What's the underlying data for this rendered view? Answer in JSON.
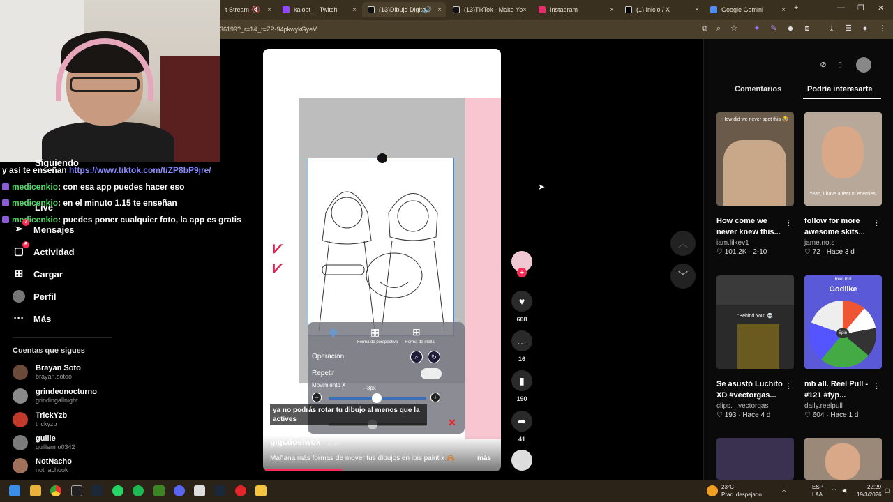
{
  "browser": {
    "tabs": [
      {
        "label": "t Stream - V",
        "color": "#b3372e"
      },
      {
        "label": "kalobt_ - Twitch",
        "color": "#9147ff"
      },
      {
        "label": "(13)Dibujo Digita",
        "color": "#111111"
      },
      {
        "label": "(13)TikTok - Make Yo",
        "color": "#111111"
      },
      {
        "label": "Instagram",
        "color": "#e1306c"
      },
      {
        "label": "(1) Inicio / X",
        "color": "#000000"
      },
      {
        "label": "Google Gemini",
        "color": "#4f8df5"
      }
    ],
    "new_tab": "+",
    "url": "36199?_r=1&_t=ZP-94pkwykGyeV"
  },
  "chat": [
    {
      "user": "",
      "text": "y así te enseñan ",
      "link": "https://www.tiktok.com/t/ZP8bP9jre/"
    },
    {
      "user": "medicenkio",
      "text": ": con esa app puedes hacer eso",
      "link": ""
    },
    {
      "user": "medicenkio",
      "text": ": en el minuto 1.15 te enseñan",
      "link": ""
    },
    {
      "user": "medicenkio",
      "text": ": puedes poner cualquier foto, la app es gratis",
      "link": ""
    }
  ],
  "sidebar": {
    "partial_items": [
      "Siguiendo",
      "Live"
    ],
    "items": [
      {
        "label": "Mensajes",
        "icon": "send-icon",
        "badge": "7"
      },
      {
        "label": "Actividad",
        "icon": "inbox-icon",
        "badge": "6"
      },
      {
        "label": "Cargar",
        "icon": "plus-icon",
        "badge": ""
      },
      {
        "label": "Perfil",
        "icon": "avatar-icon",
        "badge": ""
      },
      {
        "label": "Más",
        "icon": "more-icon",
        "badge": ""
      }
    ],
    "following_title": "Cuentas que sigues",
    "following": [
      {
        "name": "Brayan Soto",
        "handle": "brayan.sotoo",
        "color": "#6b4a3a"
      },
      {
        "name": "grindeonocturno",
        "handle": "grindingallnight",
        "color": "#8a8a8a"
      },
      {
        "name": "TrickYzb",
        "handle": "trickyzb",
        "color": "#c0392b"
      },
      {
        "name": "guille",
        "handle": "guillermo0342",
        "color": "#7a7a7a"
      },
      {
        "name": "NotNacho",
        "handle": "notnachook",
        "color": "#a0705a"
      }
    ]
  },
  "video": {
    "panel": {
      "modes": [
        "Forma de perspectiva",
        "Forma de malla"
      ],
      "operation_label": "Operación",
      "repeat_label": "Repetir",
      "move_label": "Movimiento X",
      "move_value": "- 3px"
    },
    "caption": "ya no podrás rotar tu dibujo al menos que la actives",
    "author": "gigi.doelwok",
    "date": "· 1-14",
    "description": "Mañana más formas de mover tus dibujos en ibis paint x",
    "more": "más",
    "progress_fraction": 0.33
  },
  "actions": {
    "likes": "608",
    "comments": "16",
    "saves": "190",
    "shares": "41"
  },
  "right_panel": {
    "tabs": [
      "Comentarios",
      "Podría interesarte"
    ],
    "cards": [
      {
        "title": "How come we never knew this...",
        "author": "iam.lilkev1",
        "likes": "101.2K",
        "time": "2-10",
        "overlay": "How did we never spot this 😂",
        "bg": "#6a5a4a"
      },
      {
        "title": "follow for more awesome skits...",
        "author": "jame.no.s",
        "likes": "72",
        "time": "Hace 3 d",
        "overlay": "Yeah, I have a fear of enemies.",
        "bg": "#b8a89a"
      },
      {
        "title": "Se asustó Luchito XD #vectorgas...",
        "author": "clips._.vectorgas",
        "likes": "193",
        "time": "Hace 4 d",
        "overlay": "\"Behind You\" 💀",
        "bg": "#2a2a2a"
      },
      {
        "title": "mb all. Reel Pull - #121 #fyp...",
        "author": "daily.reelpull",
        "likes": "604",
        "time": "Hace 1 d",
        "overlay": "Godlike",
        "bg": "#5a5ad8"
      },
      {
        "title": "",
        "author": "",
        "likes": "",
        "time": "",
        "overlay": "",
        "bg": "#3a3050"
      },
      {
        "title": "",
        "author": "",
        "likes": "",
        "time": "",
        "overlay": "",
        "bg": "#9a8878"
      }
    ],
    "reel_top": "Reel Pull",
    "spin": "Spin"
  },
  "taskbar": {
    "weather_temp": "23°C",
    "weather_desc": "Prac. despejado",
    "lang": "ESP",
    "lang2": "LAA",
    "time": "22:29",
    "date": "19/3/2026"
  }
}
